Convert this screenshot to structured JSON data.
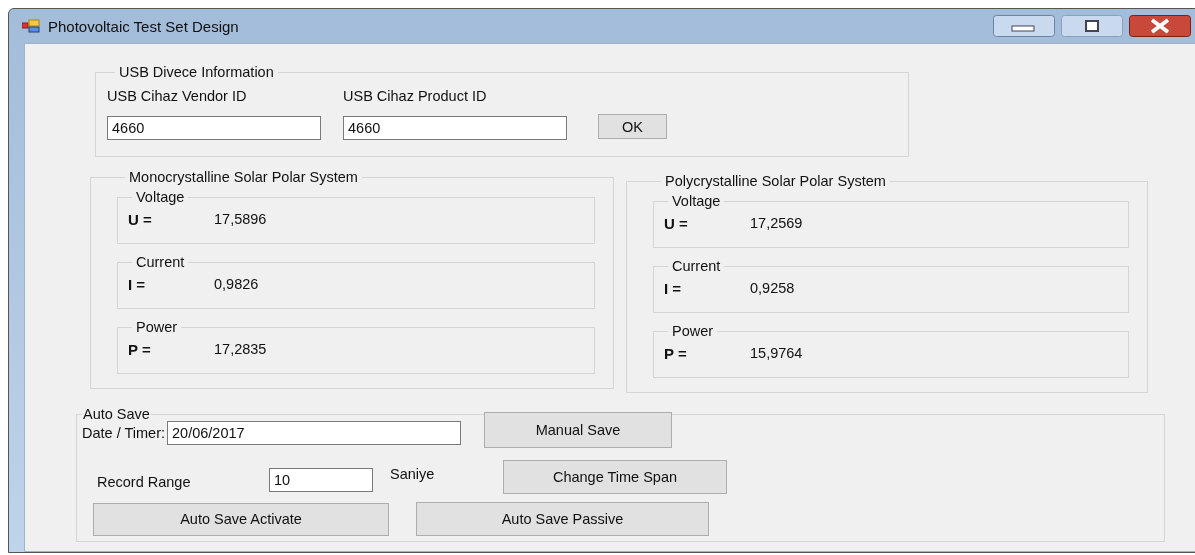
{
  "window": {
    "title": "Photovoltaic Test Set Design"
  },
  "usb": {
    "title": "USB Divece Information",
    "vendor_label": "USB Cihaz Vendor ID",
    "product_label": "USB Cihaz Product ID",
    "vendor_value": "4660",
    "product_value": "4660",
    "ok_button": "OK"
  },
  "systems": [
    {
      "title": "Monocrystalline Solar Polar System",
      "readings": [
        {
          "title": "Voltage",
          "symbol": "U =",
          "value": "17,5896"
        },
        {
          "title": "Current",
          "symbol": "I =",
          "value": "0,9826"
        },
        {
          "title": "Power",
          "symbol": "P =",
          "value": "17,2835"
        }
      ]
    },
    {
      "title": "Polycrystalline Solar Polar System",
      "readings": [
        {
          "title": "Voltage",
          "symbol": "U =",
          "value": "17,2569"
        },
        {
          "title": "Current",
          "symbol": "I =",
          "value": "0,9258"
        },
        {
          "title": "Power",
          "symbol": "P =",
          "value": "15,9764"
        }
      ]
    }
  ],
  "auto_save": {
    "title": "Auto Save",
    "date_label": "Date / Timer:",
    "date_value": "20/06/2017",
    "manual_button": "Manual Save",
    "range_label": "Record Range",
    "range_value": "10",
    "unit": "Saniye",
    "change_button": "Change Time Span",
    "activate_button": "Auto Save Activate",
    "passive_button": "Auto Save Passive"
  }
}
